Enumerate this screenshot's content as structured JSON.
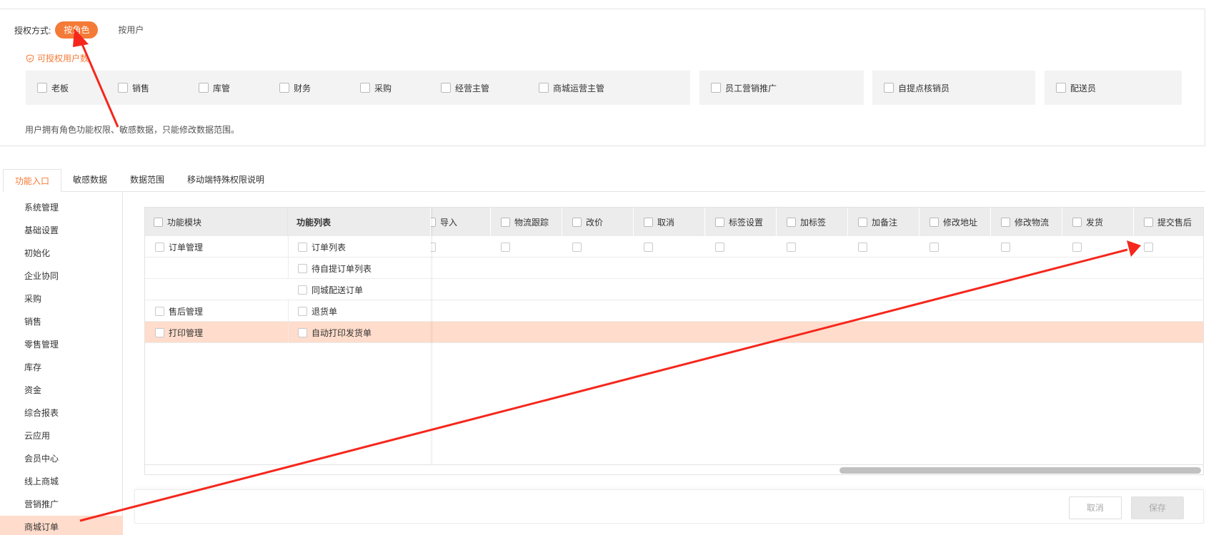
{
  "auth": {
    "label": "授权方式:",
    "modes": {
      "role": "按角色",
      "user": "按用户"
    },
    "hint": "可授权用户数",
    "roles": [
      "老板",
      "销售",
      "库管",
      "财务",
      "采购",
      "经营主管",
      "商城运营主管",
      "员工营销推广",
      "自提点核销员",
      "配送员"
    ],
    "note": "用户拥有角色功能权限、敏感数据，只能修改数据范围。"
  },
  "tabs": [
    "功能入口",
    "敏感数据",
    "数据范围",
    "移动端特殊权限说明"
  ],
  "menu": [
    "系统管理",
    "基础设置",
    "初始化",
    "企业协同",
    "采购",
    "销售",
    "零售管理",
    "库存",
    "资金",
    "综合报表",
    "云应用",
    "会员中心",
    "线上商城",
    "营销推广",
    "商城订单"
  ],
  "table": {
    "headers": {
      "module": "功能模块",
      "list": "功能列表"
    },
    "ops": [
      "导入",
      "物流跟踪",
      "改价",
      "取消",
      "标签设置",
      "加标签",
      "加备注",
      "修改地址",
      "修改物流",
      "发货",
      "提交售后"
    ],
    "rows": [
      {
        "module": "订单管理",
        "list": "订单列表"
      },
      {
        "module": "",
        "list": "待自提订单列表"
      },
      {
        "module": "",
        "list": "同城配送订单"
      },
      {
        "module": "售后管理",
        "list": "退货单"
      },
      {
        "module": "打印管理",
        "list": "自动打印发货单"
      }
    ]
  },
  "footer": {
    "cancel": "取消",
    "save": "保存"
  },
  "colors": {
    "accent": "#f47a37",
    "highlight": "#ffdccb",
    "annotation": "#f5271c"
  }
}
